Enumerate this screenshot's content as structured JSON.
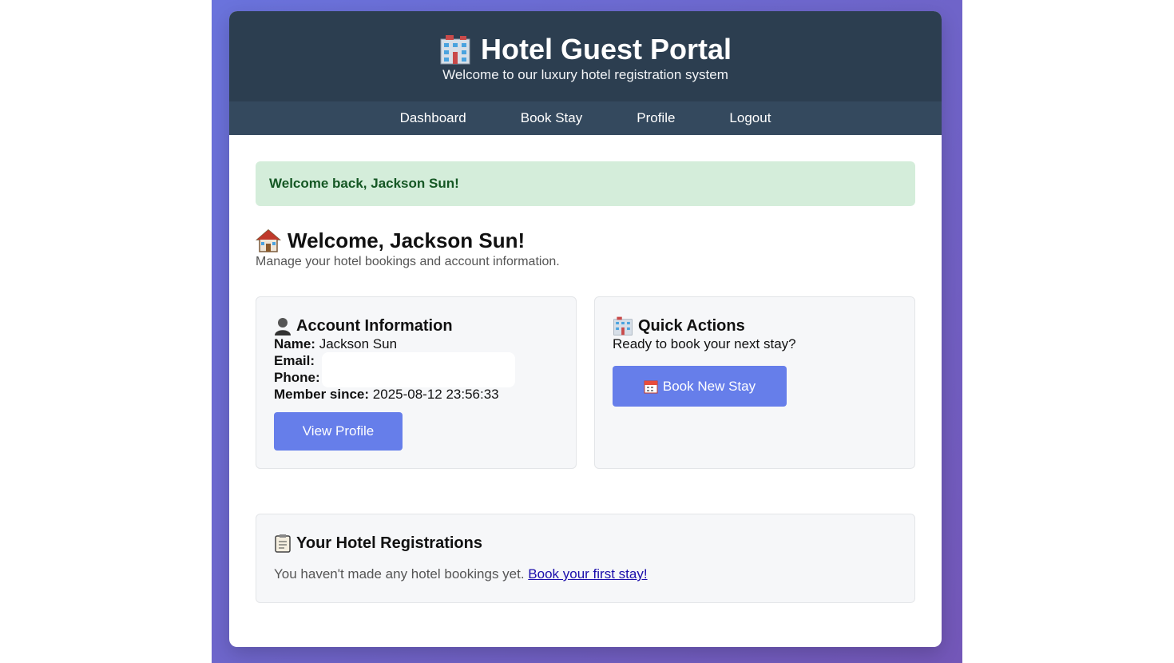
{
  "header": {
    "title": "Hotel Guest Portal",
    "subtitle": "Welcome to our luxury hotel registration system",
    "icon": "hotel-icon"
  },
  "nav": {
    "items": [
      "Dashboard",
      "Book Stay",
      "Profile",
      "Logout"
    ]
  },
  "alert": {
    "message": "Welcome back, Jackson Sun!"
  },
  "welcome": {
    "title": "Welcome, Jackson Sun!",
    "subtitle": "Manage your hotel bookings and account information.",
    "icon": "house-icon"
  },
  "account": {
    "title": "Account Information",
    "name_label": "Name:",
    "name_value": "Jackson Sun",
    "email_label": "Email:",
    "email_value": "",
    "phone_label": "Phone:",
    "phone_value": "",
    "member_label": "Member since:",
    "member_value": "2025-08-12 23:56:33",
    "button": "View Profile",
    "icon": "user-icon"
  },
  "quick_actions": {
    "title": "Quick Actions",
    "text": "Ready to book your next stay?",
    "button": "Book New Stay",
    "icon": "hotel-icon",
    "button_icon": "calendar-icon"
  },
  "registrations": {
    "title": "Your Hotel Registrations",
    "empty_text": "You haven't made any hotel bookings yet.",
    "link": "Book your first stay!",
    "icon": "clipboard-icon"
  },
  "colors": {
    "header_bg": "#2c3e50",
    "nav_bg": "#34495e",
    "accent": "#667eea",
    "alert_bg": "#d4edda",
    "alert_text": "#155724"
  }
}
